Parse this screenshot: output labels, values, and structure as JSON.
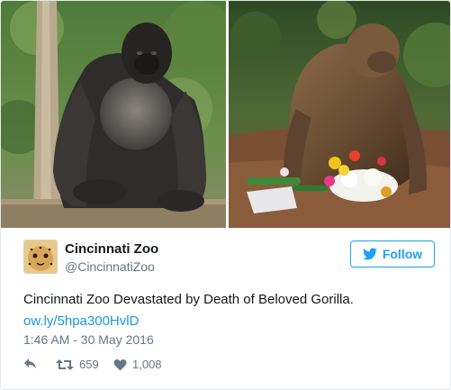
{
  "tweet": {
    "display_name": "Cincinnati Zoo",
    "handle": "@CincinnatiZoo",
    "text": "Cincinnati Zoo Devastated by Death of Beloved Gorilla.",
    "link": "ow.ly/5hpa300HvlD",
    "timestamp": "1:46 AM - 30 May 2016",
    "follow_label": "Follow",
    "retweet_count": "659",
    "like_count": "1,008"
  },
  "icons": {
    "follow": "twitter-bird-icon",
    "reply": "reply-icon",
    "retweet": "retweet-icon",
    "like": "heart-icon"
  },
  "colors": {
    "accent": "#1da1f2",
    "link": "#1b95e0",
    "muted": "#657786",
    "text": "#14171a",
    "border": "#e1e8ed"
  }
}
